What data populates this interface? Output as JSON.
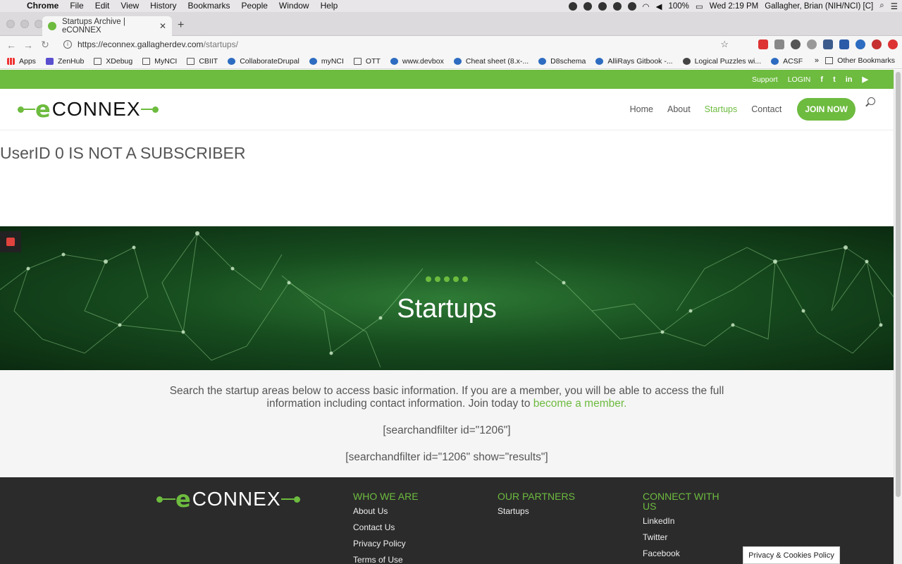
{
  "menubar": {
    "app": "Chrome",
    "items": [
      "File",
      "Edit",
      "View",
      "History",
      "Bookmarks",
      "People",
      "Window",
      "Help"
    ],
    "battery": "100%",
    "clock": "Wed 2:19 PM",
    "user": "Gallagher, Brian (NIH/NCI) [C]"
  },
  "tab": {
    "title": "Startups Archive | eCONNEX"
  },
  "omnibox": {
    "url_host": "https://econnex.gallagherdev.com",
    "url_path": "/startups/"
  },
  "bookmarks": {
    "items": [
      {
        "label": "Apps",
        "icon": "apps-grid-icon"
      },
      {
        "label": "ZenHub",
        "icon": "zenhub-icon"
      },
      {
        "label": "XDebug",
        "icon": "folder-icon"
      },
      {
        "label": "MyNCI",
        "icon": "folder-icon"
      },
      {
        "label": "CBIIT",
        "icon": "folder-icon"
      },
      {
        "label": "CollaborateDrupal",
        "icon": "confluence-icon"
      },
      {
        "label": "myNCI",
        "icon": "drupal-icon"
      },
      {
        "label": "OTT",
        "icon": "folder-icon"
      },
      {
        "label": "www.devbox",
        "icon": "drupal-icon"
      },
      {
        "label": "Cheat sheet (8.x-...",
        "icon": "drupal-icon"
      },
      {
        "label": "D8schema",
        "icon": "drupal-icon"
      },
      {
        "label": "AlliRays Gitbook -...",
        "icon": "gitbook-icon"
      },
      {
        "label": "Logical Puzzles wi...",
        "icon": "globe-icon"
      },
      {
        "label": "ACSF",
        "icon": "drupal-icon"
      }
    ],
    "more": "»",
    "other": "Other Bookmarks"
  },
  "site": {
    "topbar": {
      "support": "Support",
      "login": "LOGIN",
      "social": [
        "f",
        "t",
        "in",
        "▶"
      ]
    },
    "logo": {
      "e": "e",
      "text": "CONNEX"
    },
    "nav": {
      "home": "Home",
      "about": "About",
      "startups": "Startups",
      "contact": "Contact",
      "join": "JOIN NOW"
    },
    "notice": "UserID 0 IS NOT A SUBSCRIBER",
    "hero_title": "Startups",
    "intro_text": "Search the startup areas below to access basic information. If you are a member, you will be able to access the full information including contact information. Join today to ",
    "intro_link": "become a member.",
    "shortcode1": "[searchandfilter id=\"1206\"]",
    "shortcode2": "[searchandfilter id=\"1206\" show=\"results\"]",
    "footer": {
      "who_title": "WHO WE ARE",
      "who_links": [
        "About Us",
        "Contact Us",
        "Privacy Policy",
        "Terms of Use"
      ],
      "partners_title": "OUR PARTNERS",
      "partners_links": [
        "Startups"
      ],
      "connect_title": "CONNECT WITH US",
      "connect_links": [
        "LinkedIn",
        "Twitter",
        "Facebook"
      ]
    },
    "privacy_button": "Privacy & Cookies Policy"
  },
  "colors": {
    "brand_green": "#6dbb3f",
    "footer_bg": "#2b2b2b"
  }
}
